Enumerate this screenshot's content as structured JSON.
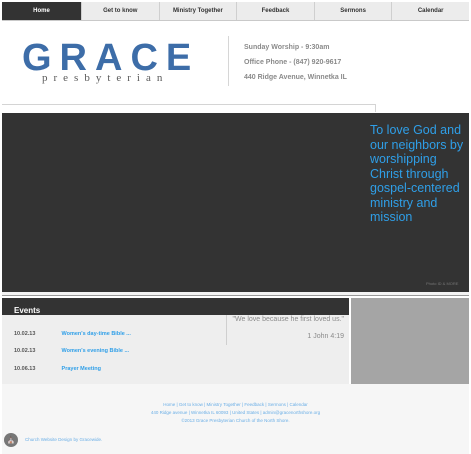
{
  "nav": {
    "items": [
      {
        "label": "Home",
        "active": true
      },
      {
        "label": "Get to know",
        "active": false
      },
      {
        "label": "Ministry Together",
        "active": false
      },
      {
        "label": "Feedback",
        "active": false
      },
      {
        "label": "Sermons",
        "active": false
      },
      {
        "label": "Calendar",
        "active": false
      }
    ]
  },
  "header": {
    "logo_word": "GRACE",
    "logo_sub": "presbyterian",
    "worship": "Sunday Worship - 9:30am",
    "phone": "Office Phone - (847) 920-9617",
    "address": "440 Ridge Avenue, Winnetka IL"
  },
  "hero": {
    "mission": "To love God and our neighbors by worshipping Christ through gospel-centered ministry and mission",
    "credit": "Photo ID & MORE",
    "background_color": "#333333",
    "text_color": "#2f9fe8"
  },
  "events": {
    "title": "Events",
    "items": [
      {
        "date": "10.02.13",
        "title": "Women's day-time Bible ..."
      },
      {
        "date": "10.02.13",
        "title": "Women's evening Bible ..."
      },
      {
        "date": "10.06.13",
        "title": "Prayer Meeting"
      }
    ],
    "quote": "\"We love because he first loved us.\"",
    "quote_ref": "1 John 4:19"
  },
  "footer": {
    "links": "Home | Get to know | Ministry Together | Feedback | Sermons | Calendar",
    "address": "440 Ridge avenue | Winnetka IL 60093 | United States | admin@gracenorthshore.org",
    "copyright": "©2013 Grace Presbyterian Church of the North Shore.",
    "designer_icon": "church-logo-icon",
    "designer_credit": "Church Website Design by Gracewide."
  },
  "colors": {
    "accent": "#2f9fe8",
    "logo": "#3d6da8",
    "dark": "#333333"
  }
}
